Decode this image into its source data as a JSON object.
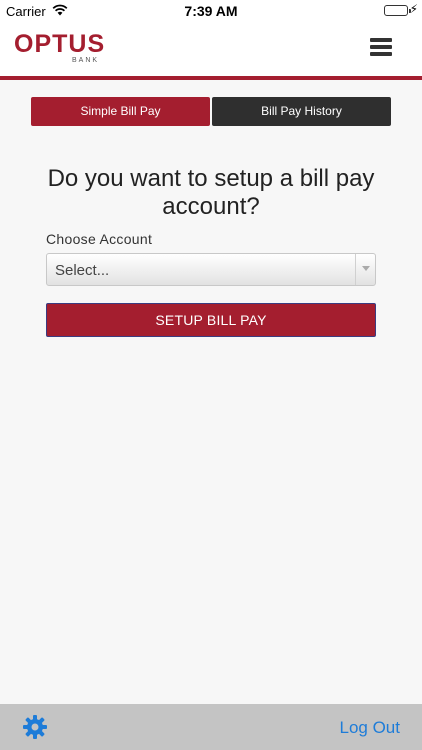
{
  "status_bar": {
    "carrier": "Carrier",
    "time": "7:39 AM"
  },
  "header": {
    "logo_word": "OPTUS",
    "logo_sub": "BANK",
    "menu_icon": "hamburger-menu-icon",
    "accent_color": "#a41e2f"
  },
  "tabs": [
    {
      "label": "Simple Bill Pay",
      "active": true
    },
    {
      "label": "Bill Pay History",
      "active": false
    }
  ],
  "main": {
    "question": "Do you want to setup a bill pay account?",
    "account_label": "Choose Account",
    "account_select_value": "Select...",
    "setup_button_label": "SETUP BILL PAY"
  },
  "footer": {
    "settings_icon": "gear-icon",
    "logout_label": "Log Out",
    "logout_color": "#1e7cd8"
  }
}
